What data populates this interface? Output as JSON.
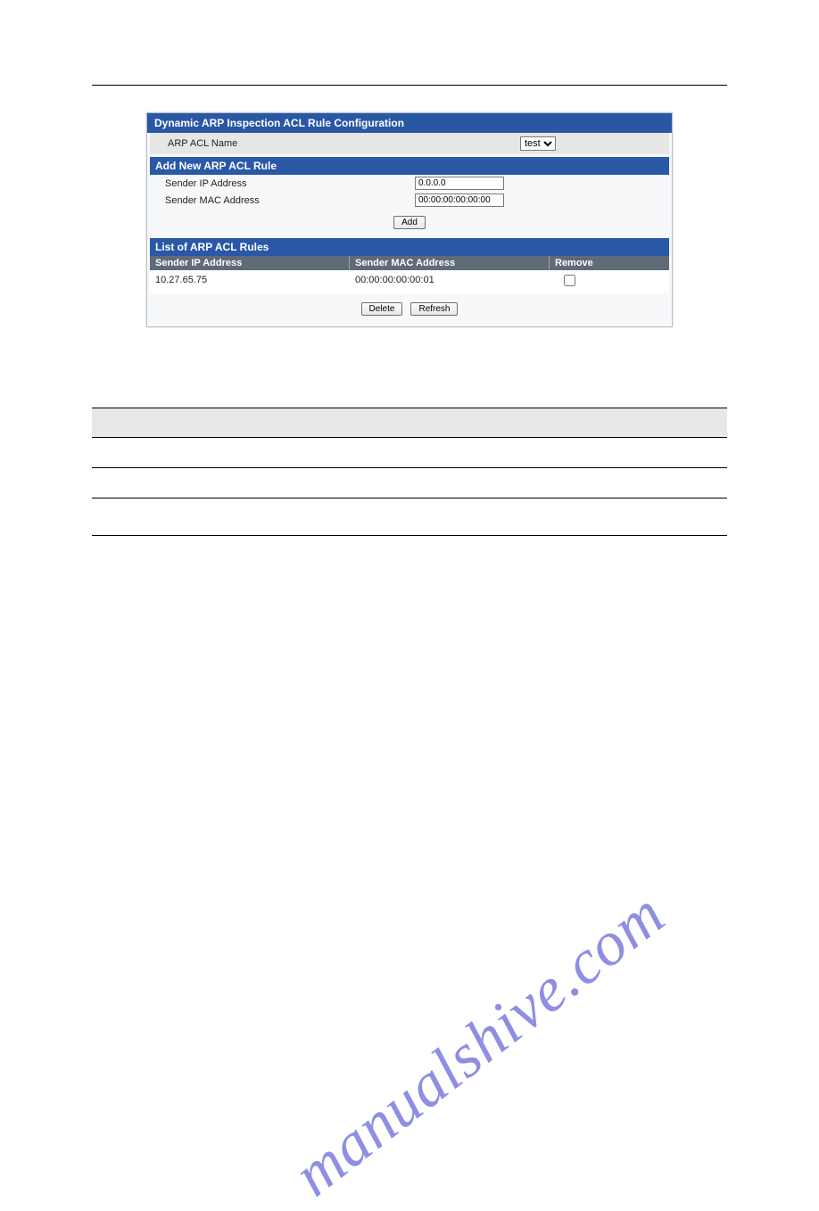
{
  "panel": {
    "title": "Dynamic ARP Inspection ACL Rule Configuration",
    "acl_name_label": "ARP ACL Name",
    "acl_name_select": "test",
    "add_section": "Add New ARP ACL Rule",
    "sender_ip_label": "Sender IP Address",
    "sender_ip_value": "0.0.0.0",
    "sender_mac_label": "Sender MAC Address",
    "sender_mac_value": "00:00:00:00:00:00",
    "add_btn": "Add",
    "list_section": "List of ARP ACL Rules",
    "col_ip": "Sender IP Address",
    "col_mac": "Sender MAC Address",
    "col_remove": "Remove",
    "row_ip": "10.27.65.75",
    "row_mac": "00:00:00:00:00:01",
    "delete_btn": "Delete",
    "refresh_btn": "Refresh"
  },
  "watermark": "manualshive.com"
}
